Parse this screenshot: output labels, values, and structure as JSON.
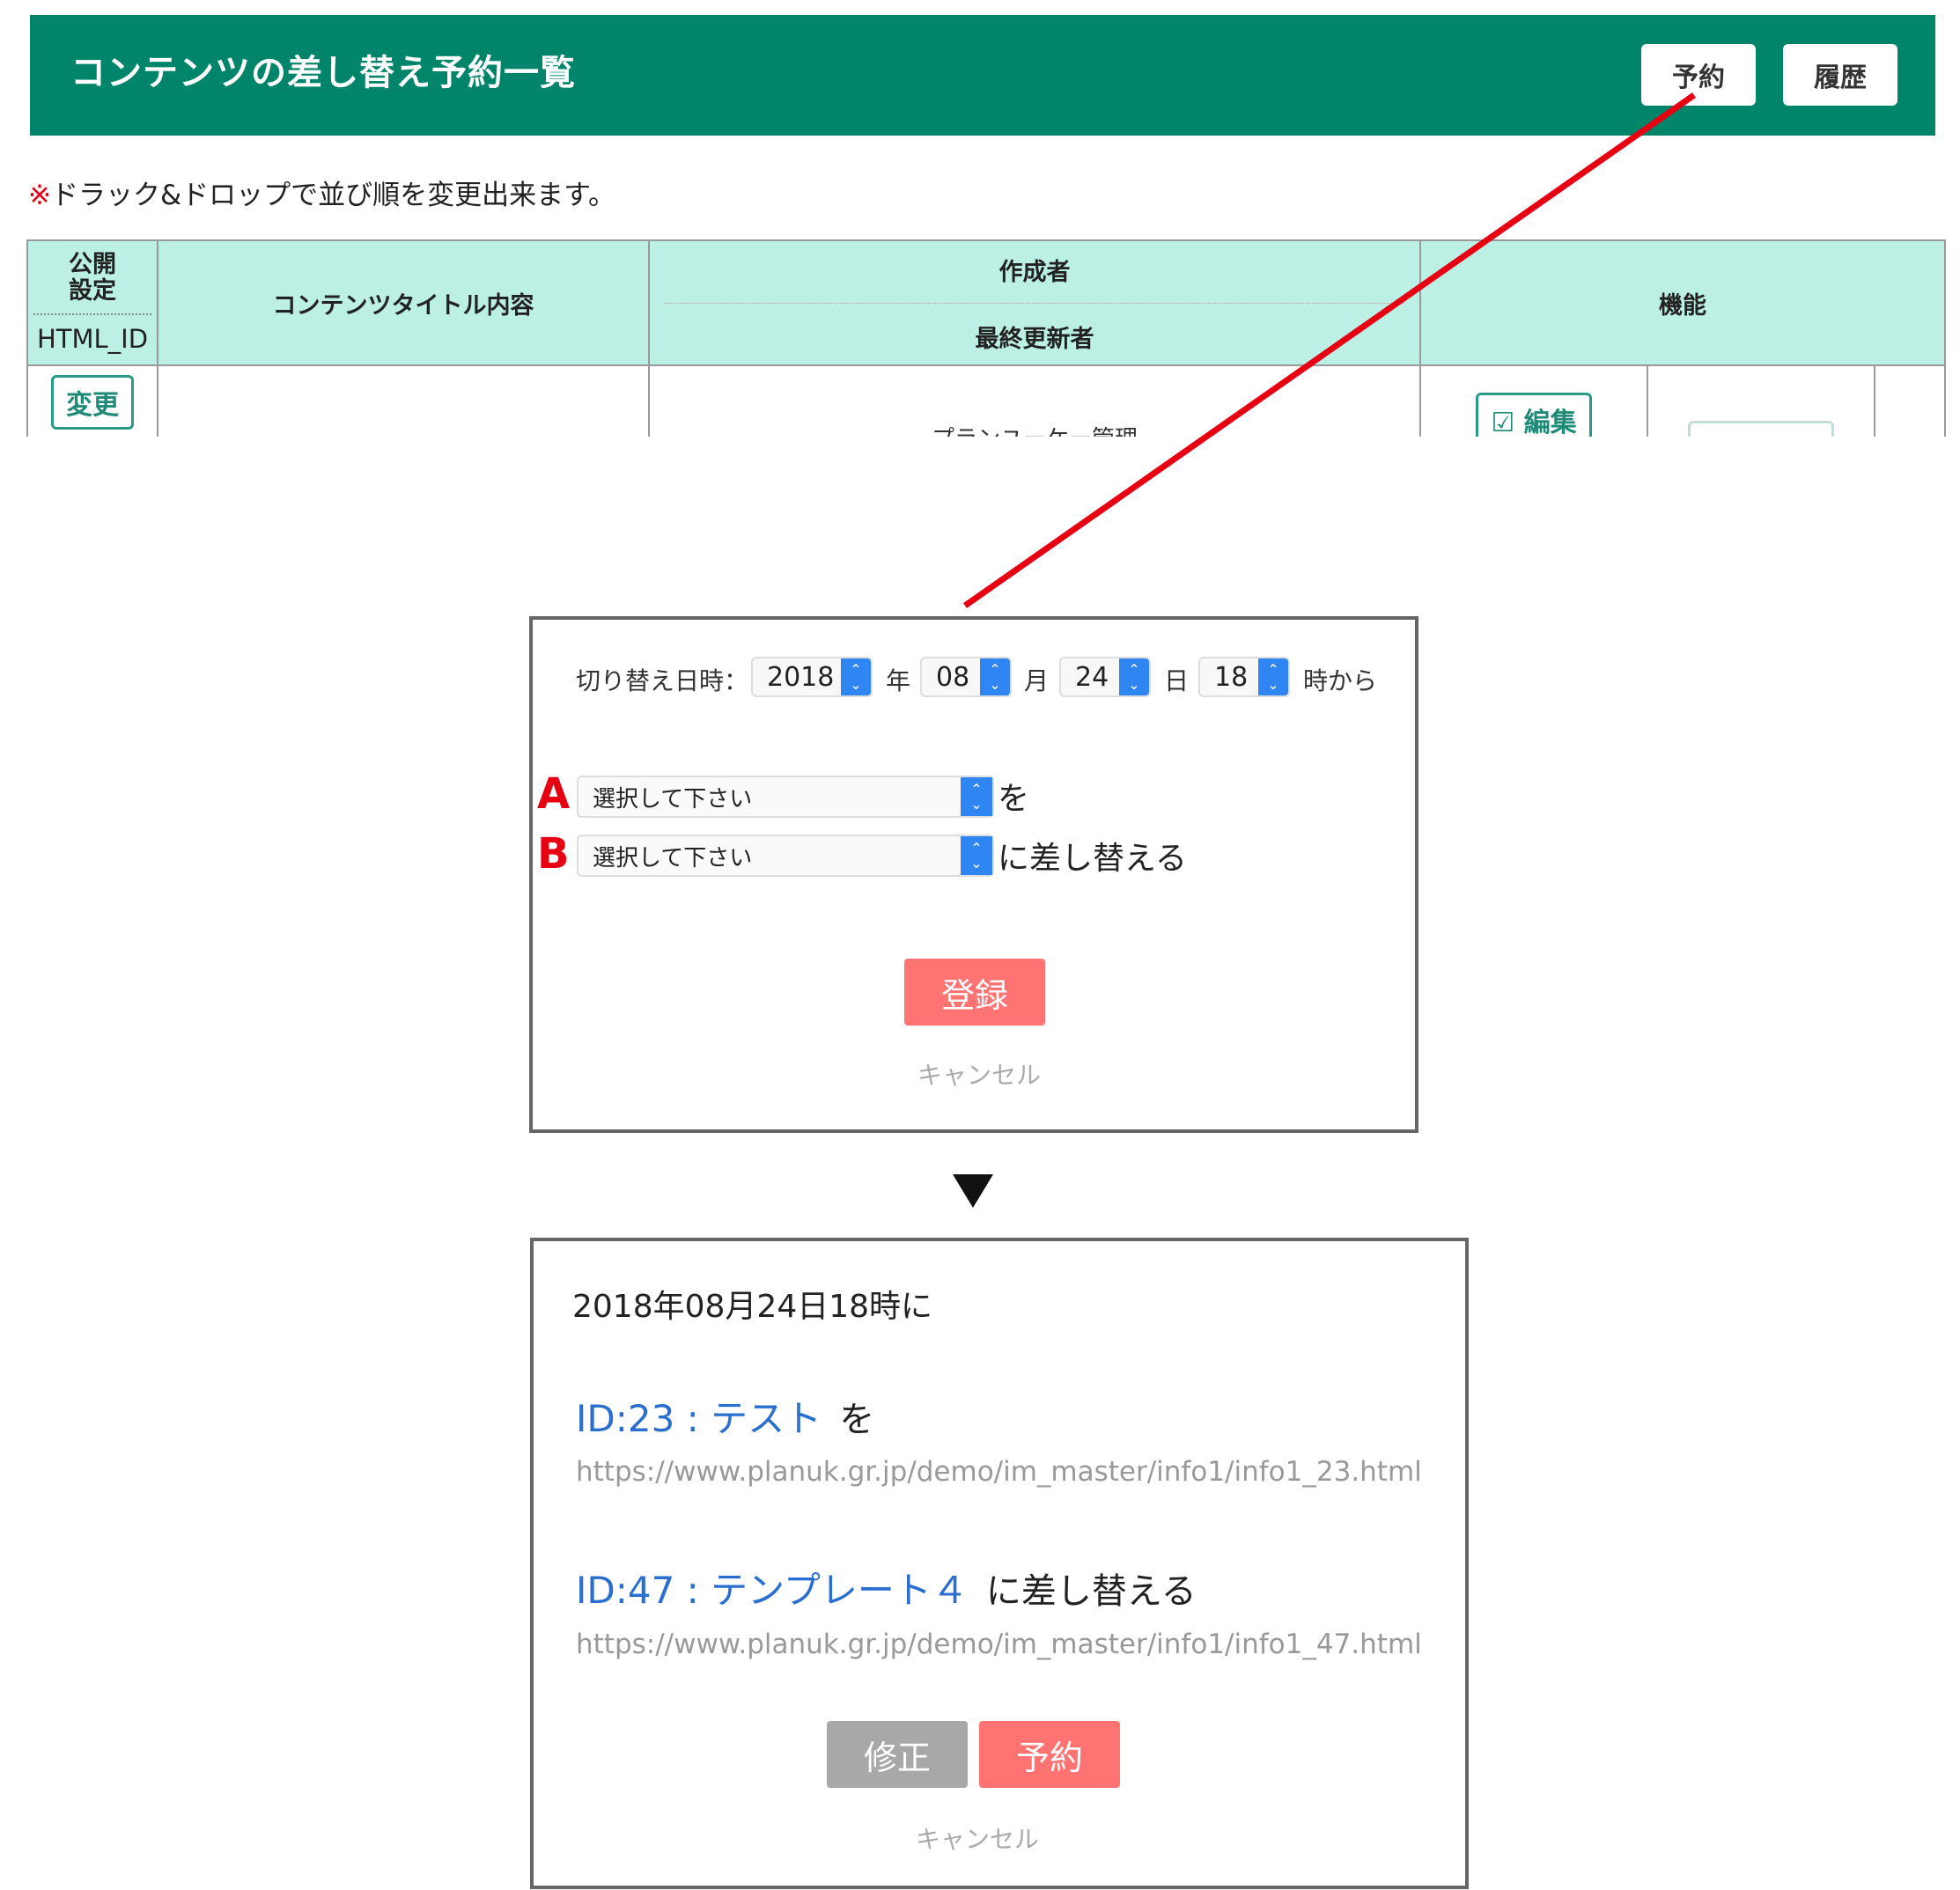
{
  "header": {
    "title": "コンテンツの差し替え予約一覧",
    "reserve_label": "予約",
    "history_label": "履歴",
    "bg_color": "#00856a"
  },
  "note": {
    "mark": "※",
    "text": "ドラック&ドロップで並び順を変更出来ます。"
  },
  "table": {
    "col1_top": "公開\n設定",
    "col1_bottom": "HTML_ID",
    "col2": "コンテンツタイトル内容",
    "col3_top": "作成者",
    "col3_bottom": "最終更新者",
    "col4": "機能",
    "row1_change_label": "変更",
    "row1_creator": "プランユーケー管理",
    "row1_edit_label": "編集",
    "header_bg": "#bdf0e5"
  },
  "dialog1": {
    "datetime_label": "切り替え日時：",
    "year_value": "2018",
    "year_unit": "年",
    "month_value": "08",
    "month_unit": "月",
    "day_value": "24",
    "day_unit": "日",
    "hour_value": "18",
    "hour_unit": "時から",
    "marker_a": "A",
    "marker_b": "B",
    "select_a_value": "選択して下さい",
    "select_a_suffix": "を",
    "select_b_value": "選択して下さい",
    "select_b_suffix": "に差し替える",
    "register_label": "登録",
    "cancel_label": "キャンセル"
  },
  "dialog2": {
    "datetime_text": "2018年08月24日18時に",
    "source_link": "ID:23 : テスト",
    "source_suffix": "を",
    "source_url": "https://www.planuk.gr.jp/demo/im_master/info1/info1_23.html",
    "target_link": "ID:47 : テンプレート４",
    "target_suffix": "に差し替える",
    "target_url": "https://www.planuk.gr.jp/demo/im_master/info1/info1_47.html",
    "edit_label": "修正",
    "reserve_label": "予約",
    "cancel_label": "キャンセル"
  },
  "colors": {
    "accent_pink": "#ff7373",
    "select_blue": "#2f86f3",
    "link_blue": "#2a6fcf",
    "connector_red": "#e60012"
  }
}
